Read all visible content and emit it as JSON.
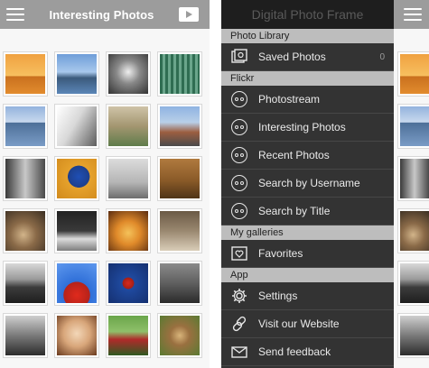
{
  "left_screen": {
    "title": "Interesting Photos",
    "menu_icon": "hamburger-icon",
    "slideshow_icon": "play-slideshow-icon"
  },
  "menu": {
    "header": "Digital Photo Frame",
    "sections": [
      {
        "title": "Photo Library",
        "items": [
          {
            "label": "Saved Photos",
            "count": "0",
            "icon": "saved-photos-icon"
          }
        ]
      },
      {
        "title": "Flickr",
        "items": [
          {
            "label": "Photostream",
            "icon": "flickr-icon"
          },
          {
            "label": "Interesting Photos",
            "icon": "flickr-icon"
          },
          {
            "label": "Recent Photos",
            "icon": "flickr-icon"
          },
          {
            "label": "Search by Username",
            "icon": "flickr-icon"
          },
          {
            "label": "Search by Title",
            "icon": "flickr-icon"
          }
        ]
      },
      {
        "title": "My galleries",
        "items": [
          {
            "label": "Favorites",
            "icon": "favorites-icon"
          }
        ]
      },
      {
        "title": "App",
        "items": [
          {
            "label": "Settings",
            "icon": "gear-icon"
          },
          {
            "label": "Visit our Website",
            "icon": "link-icon"
          },
          {
            "label": "Send feedback",
            "icon": "mail-icon"
          }
        ]
      }
    ]
  },
  "colors": {
    "topbar": "#9c9c9c",
    "menu_bg": "#333333",
    "menu_header_bg": "#1e1e1e",
    "section_bg": "#bdbdbd"
  }
}
